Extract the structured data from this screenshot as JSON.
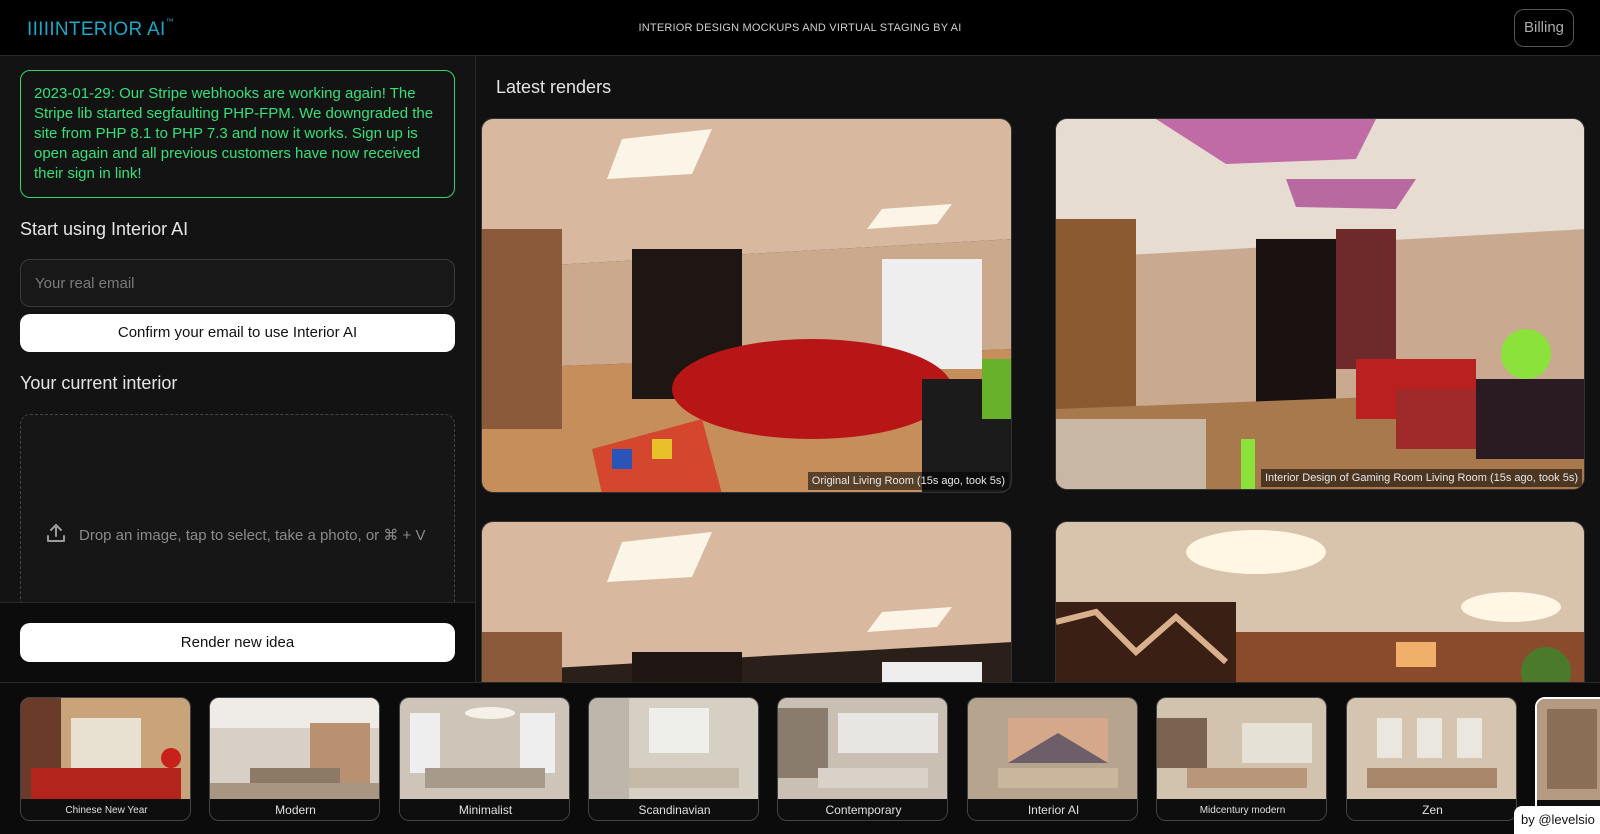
{
  "header": {
    "logo": "IIIIINTERIOR AI",
    "logo_tm": "™",
    "tagline": "INTERIOR DESIGN MOCKUPS AND VIRTUAL STAGING BY AI",
    "billing_label": "Billing"
  },
  "left": {
    "notice": "2023-01-29: Our Stripe webhooks are working again! The Stripe lib started segfaulting PHP-FPM. We downgraded the site from PHP 8.1 to PHP 7.3 and now it works. Sign up is open again and all previous customers have now received their sign in link!",
    "start_heading": "Start using Interior AI",
    "email_placeholder": "Your real email",
    "email_value": "",
    "confirm_label": "Confirm your email to use Interior AI",
    "current_heading": "Your current interior",
    "drop_text": "Drop an image, tap to select, take a photo, or ⌘ + V",
    "upload_icon": "upload-icon",
    "render_label": "Render new idea"
  },
  "right": {
    "heading": "Latest renders",
    "renders": [
      {
        "caption": "Original Living Room (15s ago, took 5s)"
      },
      {
        "caption": "Interior Design of Gaming Room Living Room (15s ago, took 5s)"
      },
      {
        "caption": ""
      },
      {
        "caption": ""
      }
    ]
  },
  "styles": [
    {
      "label": "Chinese New Year",
      "small": true
    },
    {
      "label": "Modern",
      "small": false
    },
    {
      "label": "Minimalist",
      "small": false
    },
    {
      "label": "Scandinavian",
      "small": false
    },
    {
      "label": "Contemporary",
      "small": false
    },
    {
      "label": "Interior AI",
      "small": false
    },
    {
      "label": "Midcentury modern",
      "small": true
    },
    {
      "label": "Zen",
      "small": false
    },
    {
      "label": "",
      "small": false
    }
  ],
  "byline": "by @levelsio",
  "colors": {
    "accent_logo": "#1aa7c8",
    "notice_green": "#34e07a",
    "background": "#111111"
  }
}
